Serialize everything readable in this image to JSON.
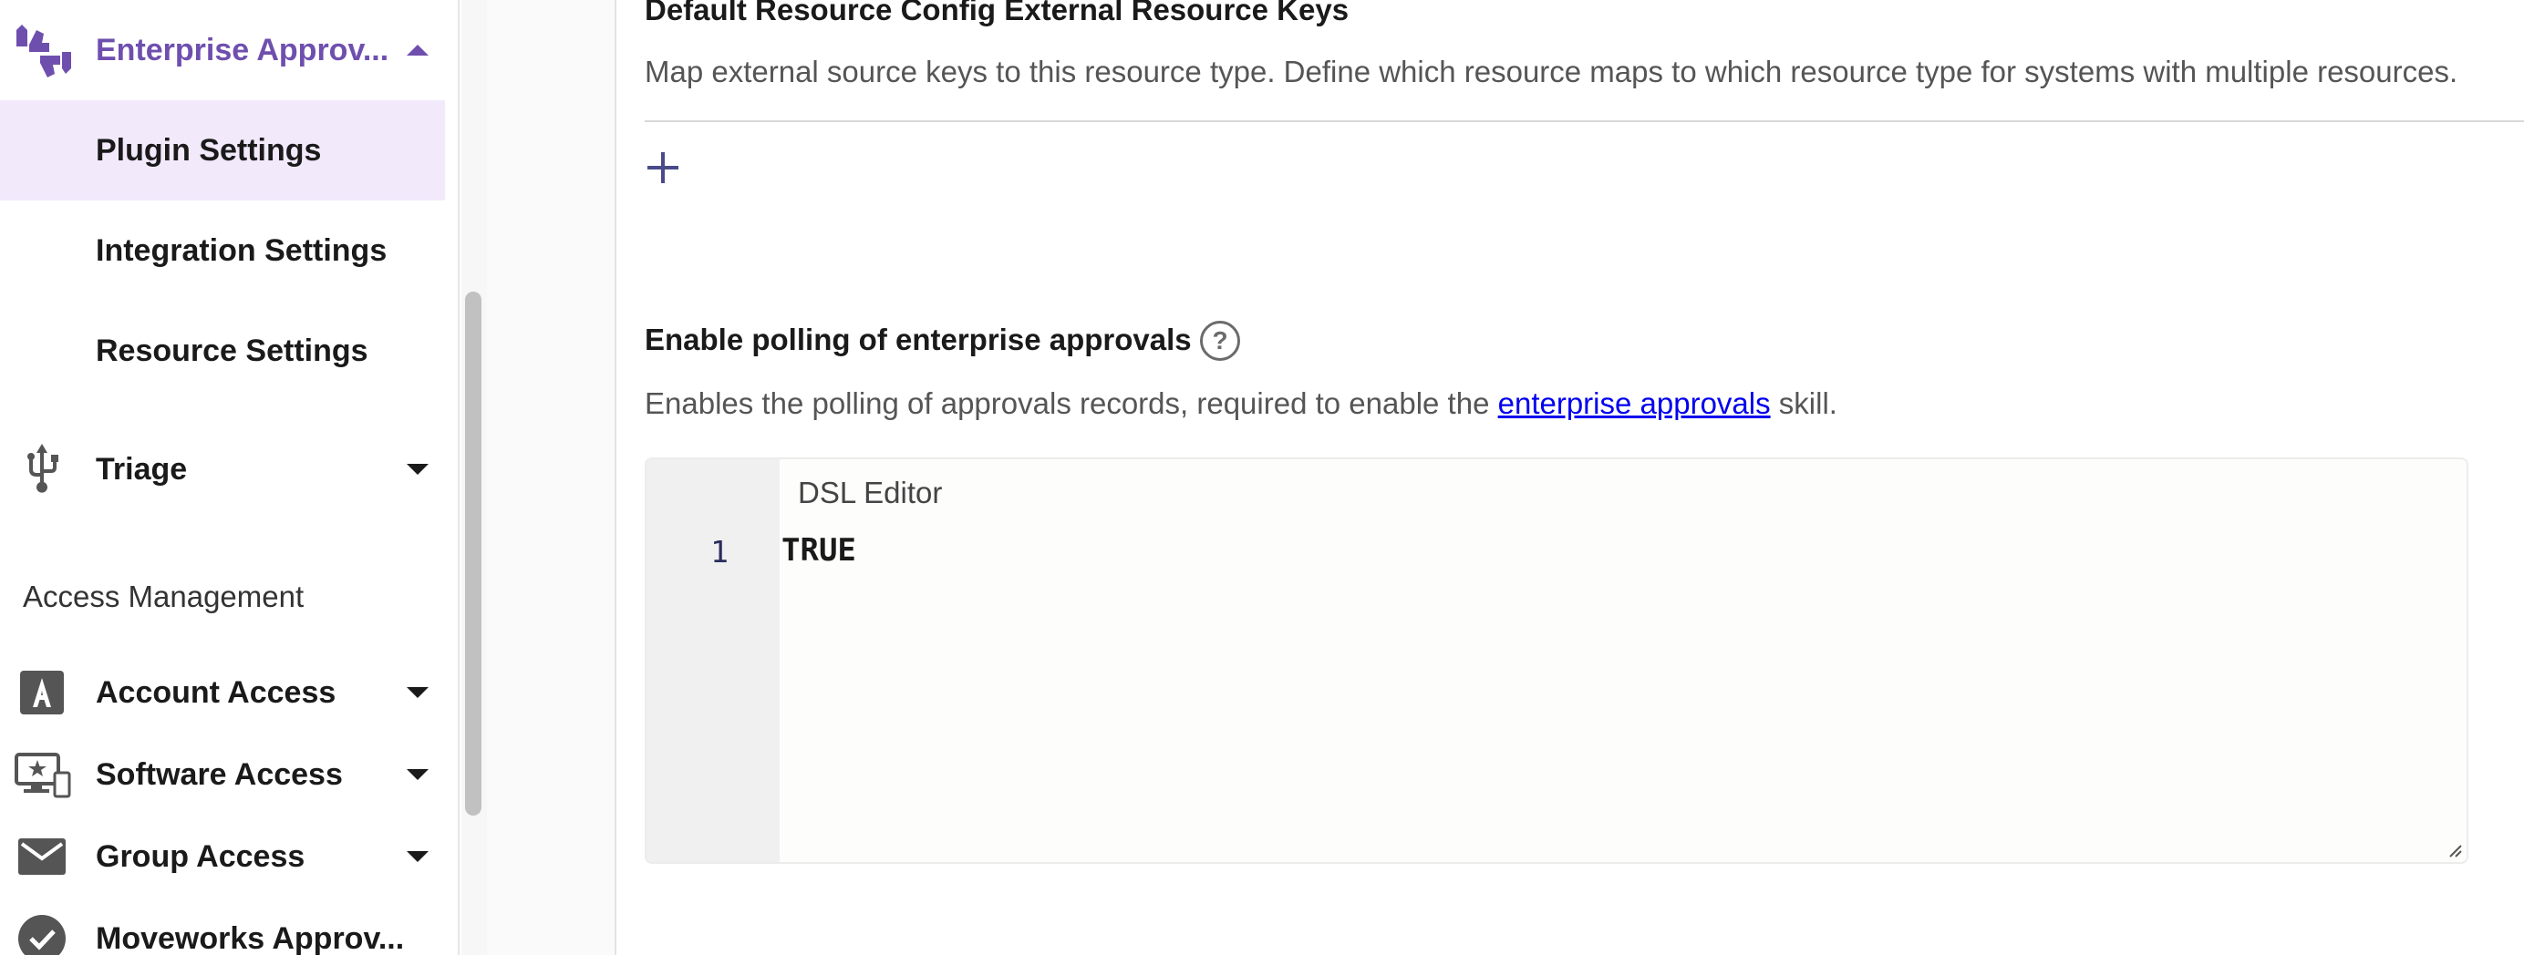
{
  "sidebar": {
    "items": [
      {
        "label": "Enterprise Approv...",
        "icon": "thumbs-up-down-icon",
        "expanded": true
      },
      {
        "label": "Triage",
        "icon": "usb-fork-icon",
        "expanded": false
      },
      {
        "label": "Account Access",
        "icon": "letter-a-box-icon",
        "expanded": false
      },
      {
        "label": "Software Access",
        "icon": "monitor-star-icon",
        "expanded": false
      },
      {
        "label": "Group Access",
        "icon": "envelope-icon",
        "expanded": false
      },
      {
        "label": "Moveworks Approv...",
        "icon": "check-circle-icon",
        "expanded": false
      }
    ],
    "subitems": [
      {
        "label": "Plugin Settings",
        "selected": true
      },
      {
        "label": "Integration Settings",
        "selected": false
      },
      {
        "label": "Resource Settings",
        "selected": false
      }
    ],
    "section_header": "Access Management"
  },
  "main": {
    "external_keys": {
      "title": "Default Resource Config External Resource Keys",
      "description": "Map external source keys to this resource type. Define which resource maps to which resource type for systems with multiple resources."
    },
    "polling": {
      "title": "Enable polling of enterprise approvals",
      "description_before": "Enables the polling of approvals records, required to enable the ",
      "link_text": "enterprise approvals",
      "description_after": " skill."
    },
    "editor": {
      "label": "DSL Editor",
      "line_number": "1",
      "code": "TRUE"
    }
  },
  "colors": {
    "accent": "#6f4fae",
    "selected_bg": "#f2e9fb",
    "link": "#0000ee"
  }
}
